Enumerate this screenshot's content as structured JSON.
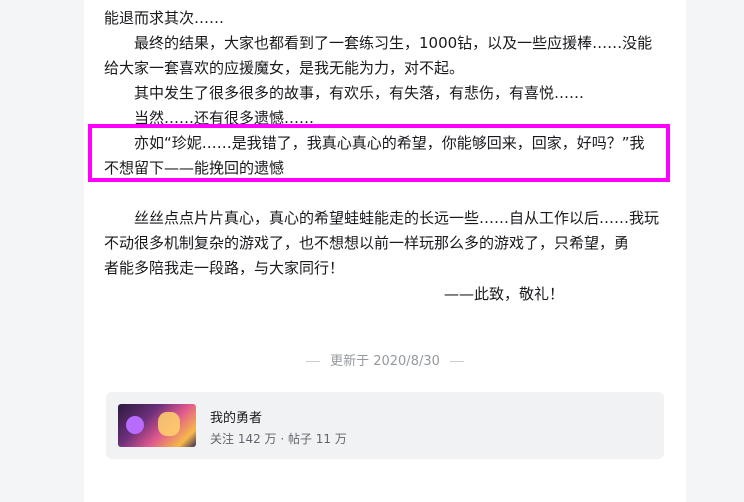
{
  "article": {
    "lines": [
      "能退而求其次……",
      "最终的结果，大家也都看到了一套练习生，1000钻，以及一些应援棒……没能",
      "给大家一套喜欢的应援魔女，是我无能为力，对不起。",
      "其中发生了很多很多的故事，有欢乐，有失落，有悲伤，有喜悦……",
      "当然……还有很多遗憾……",
      "亦如“珍妮……是我错了，我真心真心的希望，你能够回来，回家，好吗？”我",
      "不想留下——能挽回的遗憾",
      "丝丝点点片片真心，真心的希望蛙蛙能走的长远一些……自从工作以后……我玩",
      "不动很多机制复杂的游戏了，也不想想以前一样玩那么多的游戏了，只希望，勇",
      "者能多陪我走一段路，与大家同行！"
    ],
    "signature": "——此致，敬礼！"
  },
  "updated": "更新于 2020/8/30",
  "forum_card": {
    "name": "我的勇者",
    "stats": "关注 142 万 · 帖子 11 万",
    "thumbnail_icon": "game-cover-image"
  },
  "colors": {
    "highlight": "#ff00ff"
  }
}
